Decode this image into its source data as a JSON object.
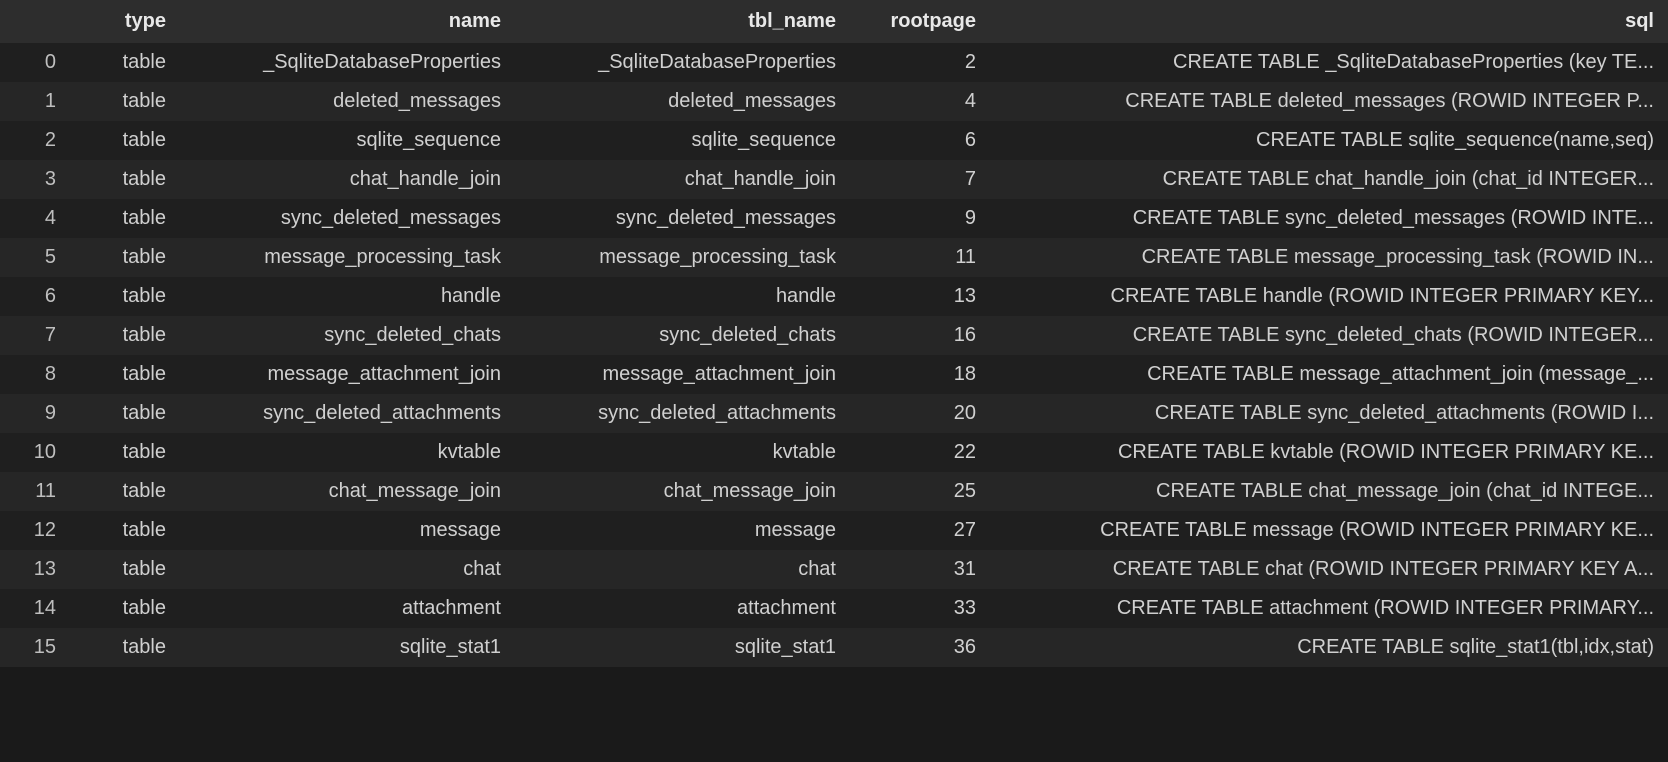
{
  "table": {
    "headers": {
      "index": "",
      "type": "type",
      "name": "name",
      "tbl_name": "tbl_name",
      "rootpage": "rootpage",
      "sql": "sql"
    },
    "rows": [
      {
        "index": "0",
        "type": "table",
        "name": "_SqliteDatabaseProperties",
        "tbl_name": "_SqliteDatabaseProperties",
        "rootpage": "2",
        "sql": "CREATE TABLE _SqliteDatabaseProperties (key TE..."
      },
      {
        "index": "1",
        "type": "table",
        "name": "deleted_messages",
        "tbl_name": "deleted_messages",
        "rootpage": "4",
        "sql": "CREATE TABLE deleted_messages (ROWID INTEGER P..."
      },
      {
        "index": "2",
        "type": "table",
        "name": "sqlite_sequence",
        "tbl_name": "sqlite_sequence",
        "rootpage": "6",
        "sql": "CREATE TABLE sqlite_sequence(name,seq)"
      },
      {
        "index": "3",
        "type": "table",
        "name": "chat_handle_join",
        "tbl_name": "chat_handle_join",
        "rootpage": "7",
        "sql": "CREATE TABLE chat_handle_join (chat_id INTEGER..."
      },
      {
        "index": "4",
        "type": "table",
        "name": "sync_deleted_messages",
        "tbl_name": "sync_deleted_messages",
        "rootpage": "9",
        "sql": "CREATE TABLE sync_deleted_messages (ROWID INTE..."
      },
      {
        "index": "5",
        "type": "table",
        "name": "message_processing_task",
        "tbl_name": "message_processing_task",
        "rootpage": "11",
        "sql": "CREATE TABLE message_processing_task (ROWID IN..."
      },
      {
        "index": "6",
        "type": "table",
        "name": "handle",
        "tbl_name": "handle",
        "rootpage": "13",
        "sql": "CREATE TABLE handle (ROWID INTEGER PRIMARY KEY..."
      },
      {
        "index": "7",
        "type": "table",
        "name": "sync_deleted_chats",
        "tbl_name": "sync_deleted_chats",
        "rootpage": "16",
        "sql": "CREATE TABLE sync_deleted_chats (ROWID INTEGER..."
      },
      {
        "index": "8",
        "type": "table",
        "name": "message_attachment_join",
        "tbl_name": "message_attachment_join",
        "rootpage": "18",
        "sql": "CREATE TABLE message_attachment_join (message_..."
      },
      {
        "index": "9",
        "type": "table",
        "name": "sync_deleted_attachments",
        "tbl_name": "sync_deleted_attachments",
        "rootpage": "20",
        "sql": "CREATE TABLE sync_deleted_attachments (ROWID I..."
      },
      {
        "index": "10",
        "type": "table",
        "name": "kvtable",
        "tbl_name": "kvtable",
        "rootpage": "22",
        "sql": "CREATE TABLE kvtable (ROWID INTEGER PRIMARY KE..."
      },
      {
        "index": "11",
        "type": "table",
        "name": "chat_message_join",
        "tbl_name": "chat_message_join",
        "rootpage": "25",
        "sql": "CREATE TABLE chat_message_join (chat_id INTEGE..."
      },
      {
        "index": "12",
        "type": "table",
        "name": "message",
        "tbl_name": "message",
        "rootpage": "27",
        "sql": "CREATE TABLE message (ROWID INTEGER PRIMARY KE..."
      },
      {
        "index": "13",
        "type": "table",
        "name": "chat",
        "tbl_name": "chat",
        "rootpage": "31",
        "sql": "CREATE TABLE chat (ROWID INTEGER PRIMARY KEY A..."
      },
      {
        "index": "14",
        "type": "table",
        "name": "attachment",
        "tbl_name": "attachment",
        "rootpage": "33",
        "sql": "CREATE TABLE attachment (ROWID INTEGER PRIMARY..."
      },
      {
        "index": "15",
        "type": "table",
        "name": "sqlite_stat1",
        "tbl_name": "sqlite_stat1",
        "rootpage": "36",
        "sql": "CREATE TABLE sqlite_stat1(tbl,idx,stat)"
      }
    ]
  }
}
